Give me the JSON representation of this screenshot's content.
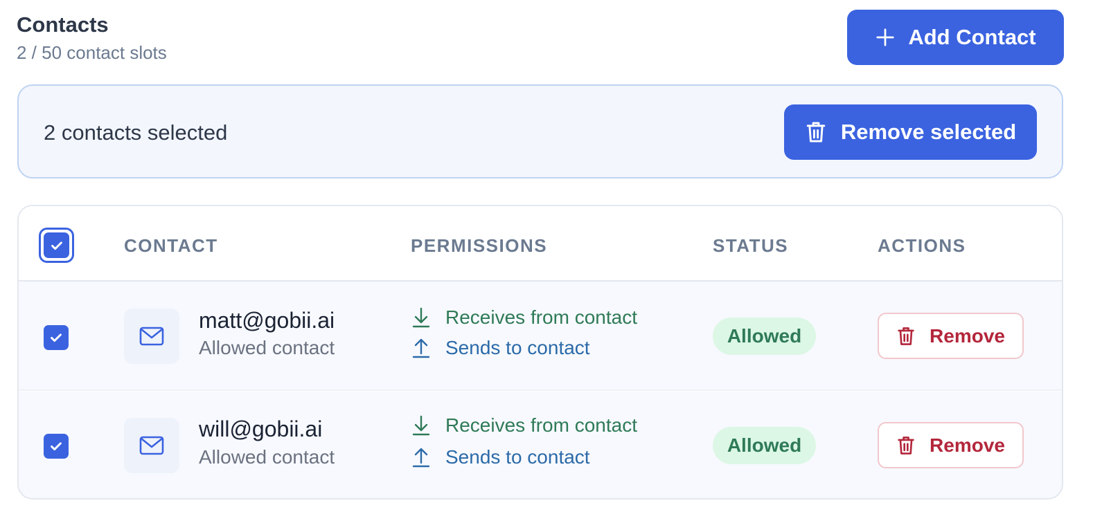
{
  "header": {
    "title": "Contacts",
    "subtitle": "2 / 50 contact slots",
    "add_button_label": "Add Contact"
  },
  "bulk_bar": {
    "selected_text": "2 contacts selected",
    "remove_selected_label": "Remove selected"
  },
  "table": {
    "columns": {
      "contact": "CONTACT",
      "permissions": "PERMISSIONS",
      "status": "STATUS",
      "actions": "ACTIONS"
    },
    "all_selected": true,
    "rows": [
      {
        "selected": true,
        "email": "matt@gobii.ai",
        "type": "Allowed contact",
        "perm_receive": "Receives from contact",
        "perm_send": "Sends to contact",
        "status": "Allowed",
        "action_label": "Remove"
      },
      {
        "selected": true,
        "email": "will@gobii.ai",
        "type": "Allowed contact",
        "perm_receive": "Receives from contact",
        "perm_send": "Sends to contact",
        "status": "Allowed",
        "action_label": "Remove"
      }
    ]
  },
  "icons": {
    "add": "plus-icon",
    "trash": "trash-icon",
    "mail": "mail-icon",
    "receive": "arrow-down-icon",
    "send": "arrow-up-icon",
    "check": "check-icon"
  },
  "colors": {
    "primary": "#3b63e0",
    "allowed_bg": "#dcf7e5",
    "allowed_text": "#2f7a57",
    "send_text": "#2c6aa8",
    "danger": "#b3263b"
  }
}
